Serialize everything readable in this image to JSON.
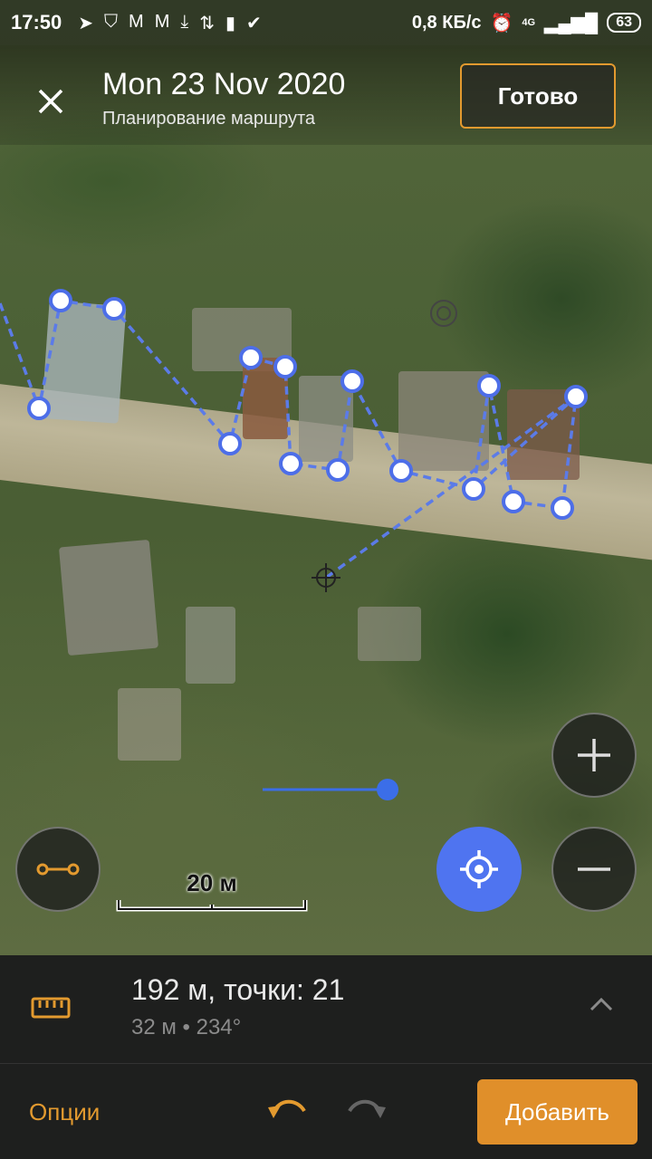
{
  "status_bar": {
    "time": "17:50",
    "network_speed": "0,8 КБ/с",
    "network_type": "4G",
    "battery": "63",
    "icons": [
      "telegram-icon",
      "shield-icon",
      "gmail-icon",
      "gmail-icon",
      "download-icon",
      "route-icon",
      "trash-icon",
      "check-icon",
      "alarm-icon",
      "signal-icon"
    ]
  },
  "header": {
    "title": "Mon 23 Nov 2020",
    "subtitle": "Планирование маршрута",
    "done_label": "Готово"
  },
  "map": {
    "scale_label": "20 м",
    "route_color": "#5b7be8"
  },
  "summary": {
    "distance_points": "192 м, точки: 21",
    "segment": "32 м • 234°"
  },
  "actions": {
    "options_label": "Опции",
    "add_label": "Добавить"
  },
  "colors": {
    "accent": "#e08f2a",
    "locate": "#4f74f0"
  }
}
